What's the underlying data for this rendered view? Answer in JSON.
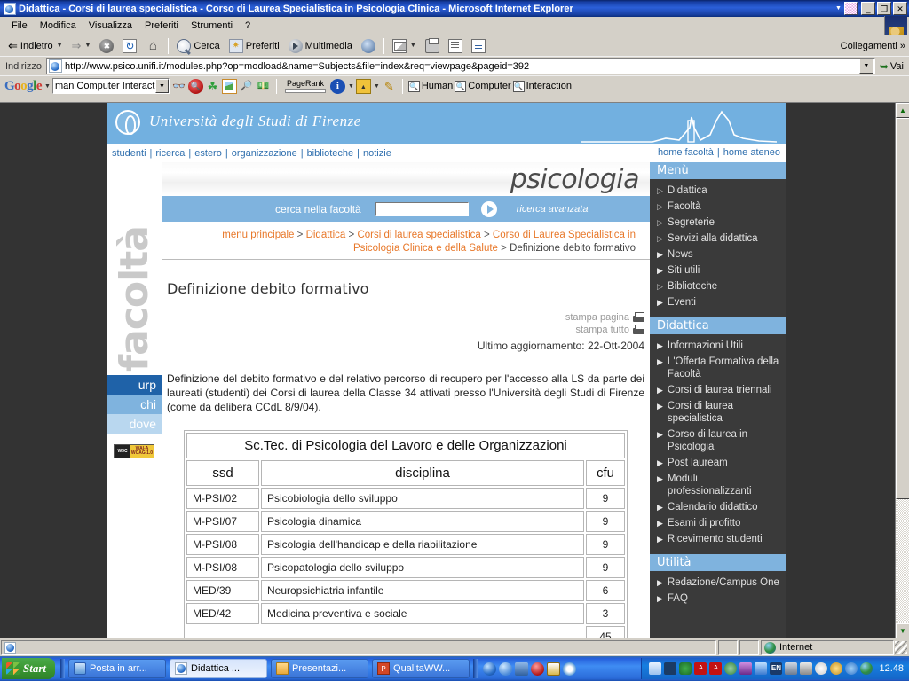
{
  "window": {
    "title": "Didattica - Corsi di laurea specialistica - Corso di Laurea Specialistica in Psicologia Clinica - Microsoft Internet Explorer",
    "minimize_label": "_",
    "restore_label": "❐",
    "close_label": "✕"
  },
  "menubar": {
    "items": [
      "File",
      "Modifica",
      "Visualizza",
      "Preferiti",
      "Strumenti",
      "?"
    ]
  },
  "toolbar": {
    "back": "Indietro",
    "forward": "",
    "stop": "",
    "refresh": "",
    "home": "",
    "search": "Cerca",
    "favorites": "Preferiti",
    "media": "Multimedia",
    "history": "",
    "mail": "",
    "print": "",
    "edit": "",
    "discuss": "",
    "links": "Collegamenti",
    "links_chevron": "»"
  },
  "address": {
    "label": "Indirizzo",
    "url": "http://www.psico.unifi.it/modules.php?op=modload&name=Subjects&file=index&req=viewpage&pageid=392",
    "go": "Vai",
    "dropdown_glyph": "▼"
  },
  "google_toolbar": {
    "logo": "Google",
    "search_value": "man Computer Interaction",
    "pagerank_label": "PageRank",
    "highlight_words": [
      "Human",
      "Computer",
      "Interaction"
    ]
  },
  "site": {
    "university": "Università degli Studi di Firenze",
    "topnav": [
      "studenti",
      "ricerca",
      "estero",
      "organizzazione",
      "biblioteche",
      "notizie"
    ],
    "topnav_right": [
      "home facoltà",
      "home ateneo"
    ],
    "faculty_watermark": "facoltà",
    "faculty_title": "psicologia",
    "search_label": "cerca nella facoltà",
    "search_value": "",
    "search_advanced": "ricerca avanzata",
    "left_tabs": [
      "urp",
      "chi",
      "dove"
    ],
    "wai_badge_left": "W3C",
    "wai_badge_line1": "WAI-A",
    "wai_badge_line2": "WCAG 1.0"
  },
  "breadcrumb": {
    "items": [
      {
        "label": "menu principale",
        "link": true
      },
      {
        "label": "Didattica",
        "link": true
      },
      {
        "label": "Corsi di laurea specialistica",
        "link": true
      },
      {
        "label": "Corso di Laurea Specialistica in Psicologia Clinica e della Salute",
        "link": true
      },
      {
        "label": "Definizione debito formativo",
        "link": false
      }
    ],
    "separator": ">"
  },
  "content": {
    "page_title": "Definizione debito formativo",
    "print_page": "stampa pagina",
    "print_all": "stampa tutto",
    "last_updated": "Ultimo aggiornamento: 22-Ott-2004",
    "intro": "Definizione del debito formativo e del relativo percorso di recupero per l'accesso alla LS da parte dei laureati (studenti) dei Corsi di laurea della Classe 34 attivati presso l'Università degli Studi di Firenze (come da delibera CCdL 8/9/04)."
  },
  "table": {
    "caption": "Sc.Tec. di Psicologia del Lavoro e delle Organizzazioni",
    "headers": [
      "ssd",
      "disciplina",
      "cfu"
    ],
    "rows": [
      {
        "ssd": "M-PSI/02",
        "disciplina": "Psicobiologia dello sviluppo",
        "cfu": "9"
      },
      {
        "ssd": "M-PSI/07",
        "disciplina": "Psicologia dinamica",
        "cfu": "9"
      },
      {
        "ssd": "M-PSI/08",
        "disciplina": "Psicologia dell'handicap e della riabilitazione",
        "cfu": "9"
      },
      {
        "ssd": "M-PSI/08",
        "disciplina": "Psicopatologia dello sviluppo",
        "cfu": "9"
      },
      {
        "ssd": "MED/39",
        "disciplina": "Neuropsichiatria infantile",
        "cfu": "6"
      },
      {
        "ssd": "MED/42",
        "disciplina": "Medicina preventiva e sociale",
        "cfu": "3"
      }
    ],
    "total": "45"
  },
  "sidebar": {
    "sections": [
      {
        "title": "Menù",
        "items": [
          {
            "label": "Didattica",
            "marker": "hollow"
          },
          {
            "label": "Facoltà",
            "marker": "hollow"
          },
          {
            "label": "Segreterie",
            "marker": "hollow"
          },
          {
            "label": "Servizi alla didattica",
            "marker": "hollow"
          },
          {
            "label": "News",
            "marker": "solid"
          },
          {
            "label": "Siti utili",
            "marker": "solid"
          },
          {
            "label": "Biblioteche",
            "marker": "hollow"
          },
          {
            "label": "Eventi",
            "marker": "solid"
          }
        ]
      },
      {
        "title": "Didattica",
        "items": [
          {
            "label": "Informazioni Utili",
            "marker": "solid"
          },
          {
            "label": "L'Offerta Formativa della Facoltà",
            "marker": "solid"
          },
          {
            "label": "Corsi di laurea triennali",
            "marker": "solid"
          },
          {
            "label": "Corsi di laurea specialistica",
            "marker": "solid"
          },
          {
            "label": "Corso di laurea in Psicologia",
            "marker": "solid"
          },
          {
            "label": "Post lauream",
            "marker": "solid"
          },
          {
            "label": "Moduli professionalizzanti",
            "marker": "solid"
          },
          {
            "label": "Calendario didattico",
            "marker": "solid"
          },
          {
            "label": "Esami di profitto",
            "marker": "solid"
          },
          {
            "label": "Ricevimento studenti",
            "marker": "solid"
          }
        ]
      },
      {
        "title": "Utilità",
        "items": [
          {
            "label": "Redazione/Campus One",
            "marker": "solid"
          },
          {
            "label": "FAQ",
            "marker": "solid"
          }
        ]
      }
    ]
  },
  "statusbar": {
    "message": "",
    "zone": "Internet"
  },
  "taskbar": {
    "start": "Start",
    "items": [
      {
        "label": "Posta in arr...",
        "icon": "outlook-icon",
        "active": false
      },
      {
        "label": "Didattica ...",
        "icon": "ie-icon",
        "active": true
      },
      {
        "label": "Presentazi...",
        "icon": "folder-icon",
        "active": false
      },
      {
        "label": "QualitaWW...",
        "icon": "powerpoint-icon",
        "active": false
      }
    ],
    "clock": "12.48"
  },
  "colors": {
    "accent_blue": "#7fb3de",
    "dark_panel": "#3a3a3a",
    "breadcrumb_link": "#e8782a",
    "nav_link": "#2f6fae"
  }
}
